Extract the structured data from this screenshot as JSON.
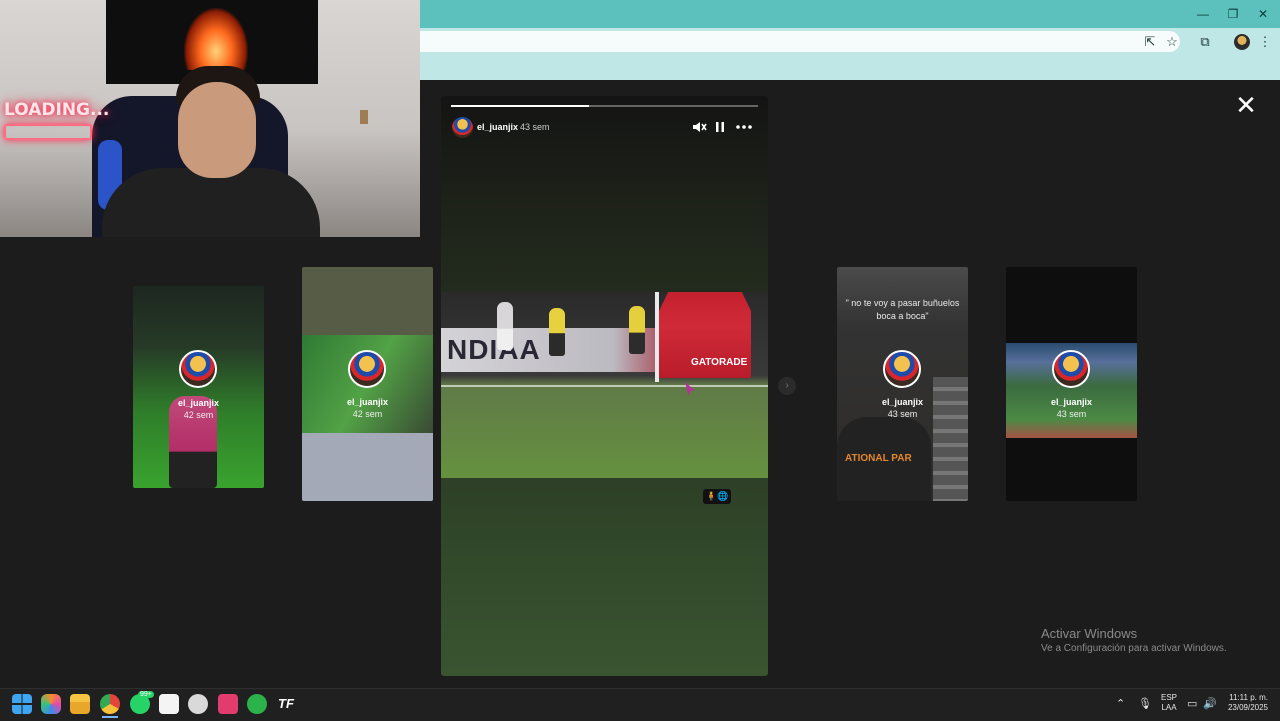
{
  "browser": {
    "window_controls": {
      "minimize": "—",
      "restore": "❐",
      "close": "✕"
    },
    "toolbar_icons": [
      "share-icon",
      "star-icon",
      "extensions-icon",
      "profile-avatar",
      "kebab-menu-icon"
    ]
  },
  "webcam": {
    "sign_text": "LOADING..."
  },
  "story_viewer": {
    "close_label": "✕",
    "main_story": {
      "username": "el_juanjix",
      "time": "43 sem",
      "progress": 0.45,
      "banner_text": "NDIAA",
      "tent_text": "GATORADE",
      "sticker": "🧍🌐"
    },
    "side_cards": [
      {
        "username": "el_juanjix",
        "time": "42 sem"
      },
      {
        "username": "el_juanjix",
        "time": "42 sem"
      },
      {
        "username": "el_juanjix",
        "time": "43 sem",
        "caption": "\" no te voy a pasar buñuelos boca a boca\""
      },
      {
        "username": "el_juanjix",
        "time": "43 sem"
      }
    ],
    "hoodie_print": "ATIONAL PAR",
    "next_label": "›"
  },
  "activation": {
    "title": "Activar Windows",
    "subtitle": "Ve a Configuración para activar Windows."
  },
  "taskbar": {
    "whatsapp_badge": "99+",
    "tf_label": "TF",
    "tray": {
      "chevron": "⌃",
      "lang_top": "ESP",
      "lang_bottom": "LAA",
      "time": "11:11 p. m.",
      "date": "23/09/2025"
    }
  }
}
